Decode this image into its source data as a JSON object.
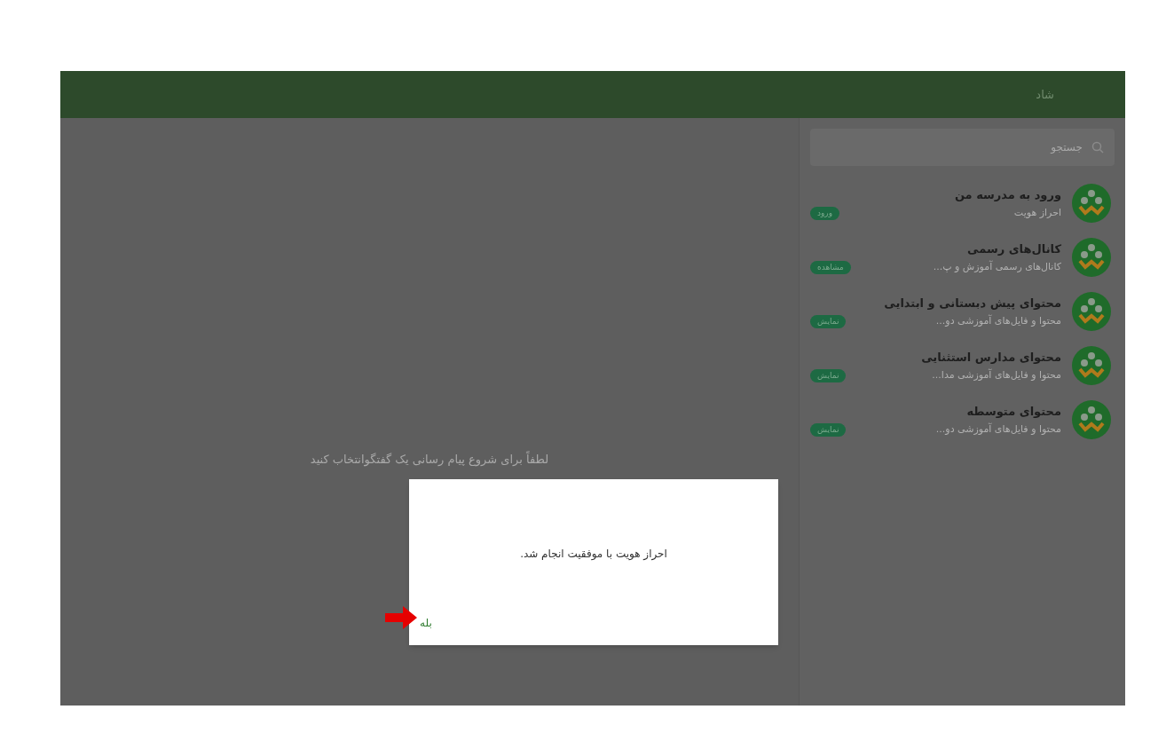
{
  "header": {
    "title": "شاد"
  },
  "search": {
    "placeholder": "جستجو"
  },
  "chats": [
    {
      "name": "ورود به مدرسه من",
      "preview": "احراز هویت",
      "badge": "ورود"
    },
    {
      "name": "کانال‌های رسمی",
      "preview": "کانال‌های رسمی آموزش و پ...",
      "badge": "مشاهده"
    },
    {
      "name": "محتوای پیش دبستانی و ابتدایی",
      "preview": "محتوا و فایل‌های آموزشی دو...",
      "badge": "نمایش"
    },
    {
      "name": "محتوای مدارس استثنایی",
      "preview": "محتوا و فایل‌های آموزشی مدا...",
      "badge": "نمایش"
    },
    {
      "name": "محتوای متوسطه",
      "preview": "محتوا و فایل‌های آموزشی دو...",
      "badge": "نمایش"
    }
  ],
  "empty_message": "لطفاً برای شروع پیام رسانی یک گفتگوانتخاب کنید",
  "dialog": {
    "message": "احراز هویت با موفقیت انجام شد.",
    "button": "بله"
  }
}
